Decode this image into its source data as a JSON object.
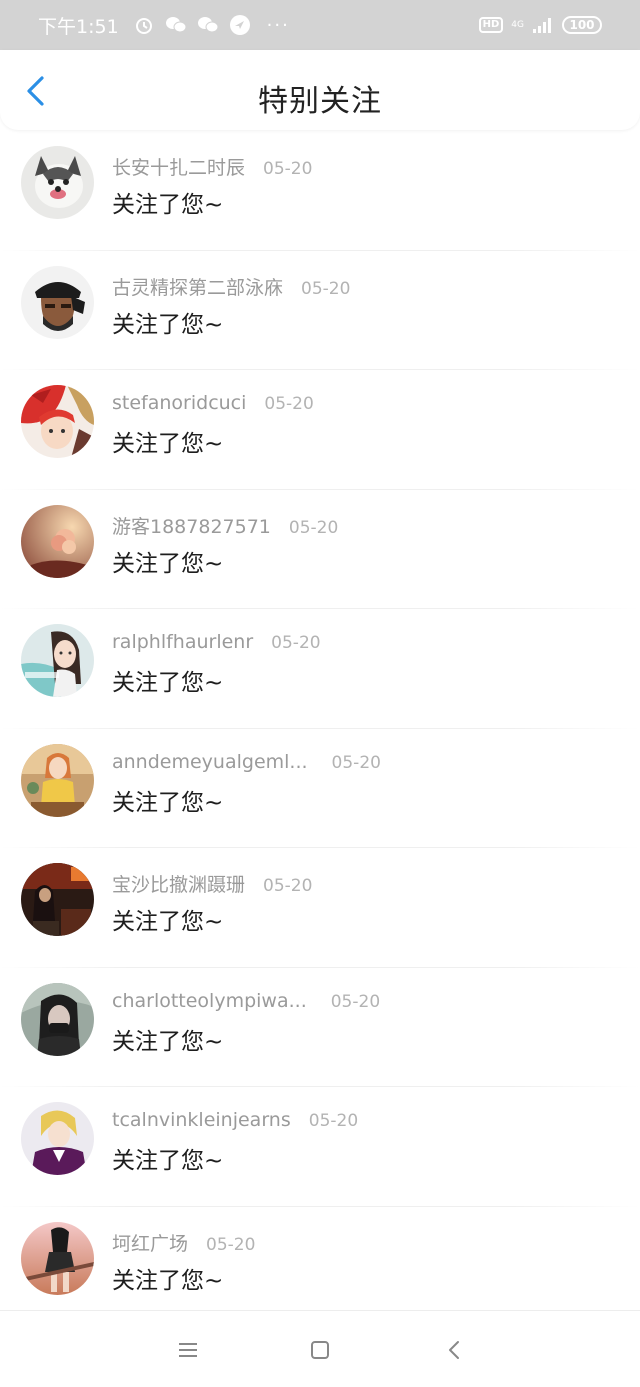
{
  "status_bar": {
    "time": "下午1:51",
    "left_icons": [
      "alarm-icon",
      "wechat-icon",
      "wechat-icon",
      "message-icon"
    ],
    "more": "···",
    "hd": "HD",
    "network": "4G",
    "battery": "100"
  },
  "header": {
    "title": "特别关注",
    "back_icon": "chevron-left-icon",
    "accent_color": "#2b8fe6"
  },
  "notifications": [
    {
      "name": "长安十扎二时辰",
      "date": "05-20",
      "message": "关注了您~"
    },
    {
      "name": "古灵精探第二部泳庥",
      "date": "05-20",
      "message": "关注了您~"
    },
    {
      "name": "stefanoridcuci",
      "date": "05-20",
      "message": "关注了您~"
    },
    {
      "name": "游客1887827571",
      "date": "05-20",
      "message": "关注了您~"
    },
    {
      "name": "ralphlfhaurlenr",
      "date": "05-20",
      "message": "关注了您~"
    },
    {
      "name": "anndemeyualgeml...",
      "date": "05-20",
      "message": "关注了您~"
    },
    {
      "name": "宝沙比撤渊蹑珊",
      "date": "05-20",
      "message": "关注了您~"
    },
    {
      "name": "charlotteolympiwa...",
      "date": "05-20",
      "message": "关注了您~"
    },
    {
      "name": "tcalnvinkleinjearns",
      "date": "05-20",
      "message": "关注了您~"
    },
    {
      "name": "坷红广场",
      "date": "05-20",
      "message": "关注了您~"
    }
  ],
  "nav_bar": {
    "icons": [
      "menu-icon",
      "home-square-icon",
      "back-triangle-icon"
    ]
  }
}
